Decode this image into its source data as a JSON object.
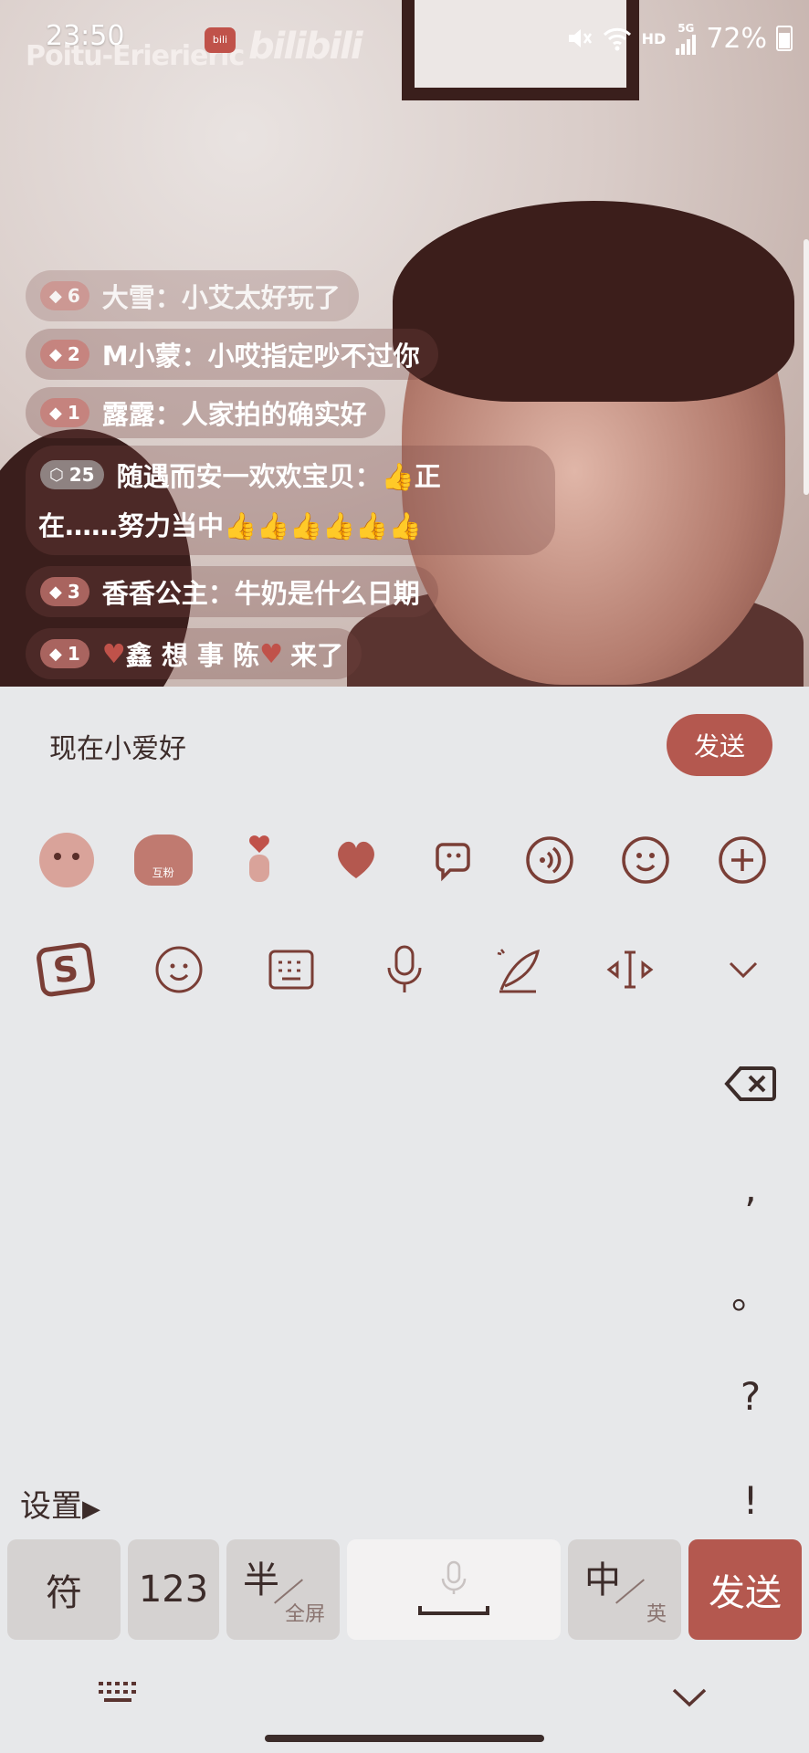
{
  "status_bar": {
    "time": "23:50",
    "channel": "Poitu-Erierieric",
    "app_logo": "bilibili",
    "network": "HD",
    "signal": "5G",
    "battery": "72%"
  },
  "chat": [
    {
      "level": "6",
      "name": "大雪",
      "text": "小艾太好玩了"
    },
    {
      "level": "2",
      "name": "M小蒙",
      "text": "小哎指定吵不过你"
    },
    {
      "level": "1",
      "name": "露露",
      "text": "人家拍的确实好"
    },
    {
      "level": "25",
      "name": "随遇而安一欢欢宝贝",
      "text": "👍正",
      "text2": "在……努力当中👍👍👍👍👍👍"
    },
    {
      "level": "3",
      "name": "香香公主",
      "text": "牛奶是什么日期"
    },
    {
      "level": "1",
      "name": "鑫 想 事 陈",
      "text": "来了"
    }
  ],
  "input": {
    "value": "现在小爱好",
    "send_label": "发送"
  },
  "emoji_panel": {
    "badge_label": "互粉"
  },
  "punctuation": [
    ",",
    "。",
    "?",
    "!"
  ],
  "settings_label": "设置",
  "keyboard": {
    "sym": "符",
    "num": "123",
    "half_top": "半",
    "half_bottom": "全屏",
    "zh_top": "中",
    "zh_bottom": "英",
    "send": "发送"
  },
  "colors": {
    "accent": "#b4584f",
    "background": "#e7e8ea",
    "key": "#d5d2d1"
  }
}
